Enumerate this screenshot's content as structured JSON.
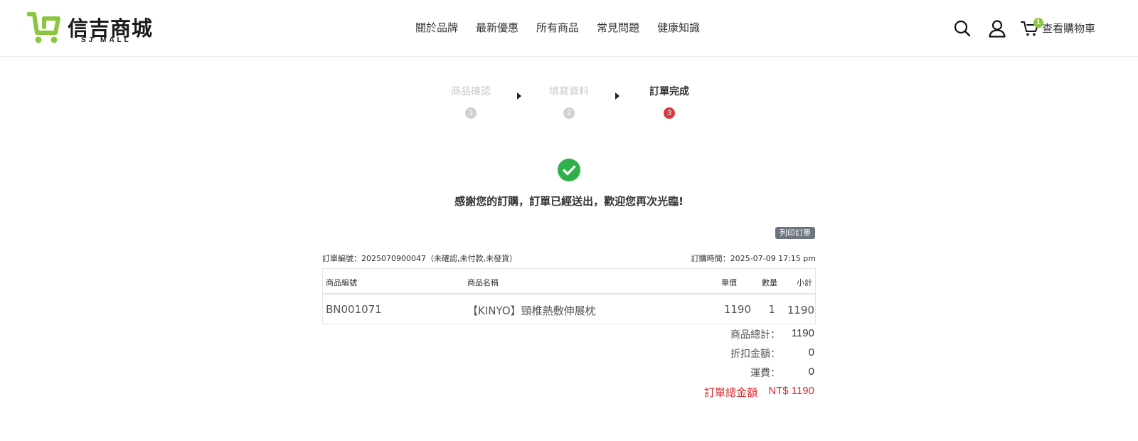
{
  "colors": {
    "brand": "#8cc63f",
    "success": "#2fb04a",
    "active_step": "#d9363e",
    "total": "#e0262a"
  },
  "header": {
    "logo_text": "信吉商城",
    "logo_sub": "SJ MALL",
    "nav": [
      "關於品牌",
      "最新優惠",
      "所有商品",
      "常見問題",
      "健康知識"
    ],
    "icons": [
      "search-icon",
      "user-icon",
      "cart-icon"
    ],
    "cart_count": "1",
    "cart_label": "查看購物車"
  },
  "steps": [
    {
      "label": "商品確認",
      "num": "1",
      "state": "done"
    },
    {
      "label": "填寫資料",
      "num": "2",
      "state": "done"
    },
    {
      "label": "訂單完成",
      "num": "3",
      "state": "active"
    }
  ],
  "result": {
    "icon": "check-circle-icon",
    "message": "感謝您的訂購，訂單已經送出，歡迎您再次光臨!",
    "print_label": "列印訂單"
  },
  "order": {
    "number_text": "訂單編號：2025070900047（未確認,未付款,未發貨）",
    "time_text": "訂購時間：2025-07-09 17:15 pm",
    "columns": [
      "商品編號",
      "商品名稱",
      "單價",
      "數量",
      "小計"
    ],
    "rows": [
      {
        "sku": "BN001071",
        "name": "【KINYO】頸椎熱敷伸展枕",
        "price": "1190",
        "qty": "1",
        "subtotal": "1190"
      }
    ],
    "summary": [
      {
        "label": "商品總計：",
        "value": "1190"
      },
      {
        "label": "折扣金額：",
        "value": "0"
      },
      {
        "label": "運費：",
        "value": "0"
      }
    ],
    "total_label": "訂單總金額",
    "total_value": "NT$ 1190"
  }
}
